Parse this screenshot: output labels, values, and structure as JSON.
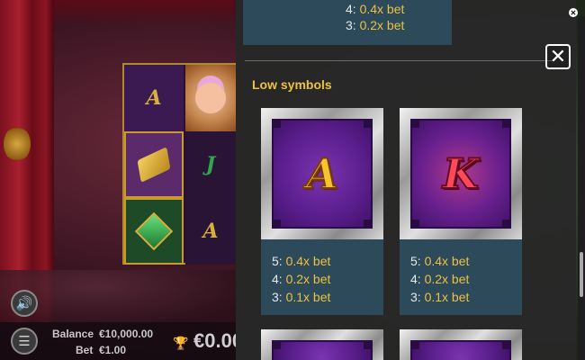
{
  "game": {
    "balance_label": "Balance",
    "balance_value": "€10,000.00",
    "bet_label": "Bet",
    "bet_value": "€1.00",
    "win_value": "€0.00",
    "reel_letters": {
      "a_top": "A",
      "j_mid": "J",
      "a_bottom": "A"
    }
  },
  "paytable": {
    "previous_payouts": [
      {
        "count": "4:",
        "amount": "0.4x bet"
      },
      {
        "count": "3:",
        "amount": "0.2x bet"
      }
    ],
    "section_title": "Low symbols",
    "symbols": [
      {
        "letter": "A",
        "payouts": [
          {
            "count": "5:",
            "amount": "0.4x bet"
          },
          {
            "count": "4:",
            "amount": "0.2x bet"
          },
          {
            "count": "3:",
            "amount": "0.1x bet"
          }
        ]
      },
      {
        "letter": "K",
        "payouts": [
          {
            "count": "5:",
            "amount": "0.4x bet"
          },
          {
            "count": "4:",
            "amount": "0.2x bet"
          },
          {
            "count": "3:",
            "amount": "0.1x bet"
          }
        ]
      }
    ],
    "close_icon": "close-icon"
  },
  "colors": {
    "accent": "#f0c040",
    "card_bg": "#2c4a5a",
    "panel_bg": "#282828"
  }
}
